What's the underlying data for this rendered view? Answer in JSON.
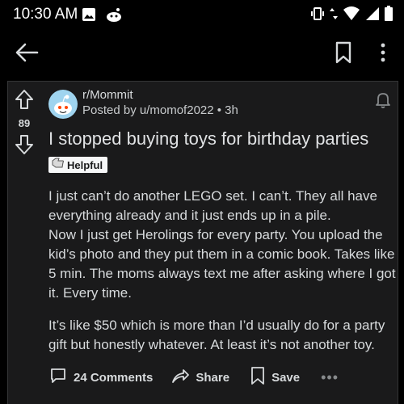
{
  "status_bar": {
    "time": "10:30 AM",
    "left_icons": [
      "image-icon",
      "reddit-notification-icon"
    ],
    "right_icons": [
      "vibrate-icon",
      "data-arrows-icon",
      "wifi-icon",
      "cell-signal-icon",
      "battery-icon"
    ]
  },
  "app_bar": {
    "icons": [
      "back-arrow-icon",
      "bookmark-icon",
      "more-vertical-icon"
    ]
  },
  "post": {
    "vote_count": "89",
    "subreddit": "r/Mommit",
    "byline": "Posted by u/momof2022 • 3h",
    "title": "I stopped buying toys for birthday parties",
    "award_label": "Helpful",
    "body": [
      "I just can’t do another LEGO set. I can’t. They all have everything already and it just ends up in a pile.\nNow I just get Herolings for every party. You upload the kid’s photo and they put them in a comic book. Takes like 5 min. The moms always text me after asking where I got it. Every time.",
      "It’s like $50 which is more than I’d usually do for a party gift but honestly whatever. At least it’s not another toy."
    ]
  },
  "actions": {
    "comments_label": "24 Comments",
    "share_label": "Share",
    "save_label": "Save",
    "more_label": "•••"
  },
  "colors": {
    "background": "#000000",
    "card": "#1a1a1b",
    "text": "#d7dadc",
    "avatar_bg": "#9fd4ef"
  }
}
